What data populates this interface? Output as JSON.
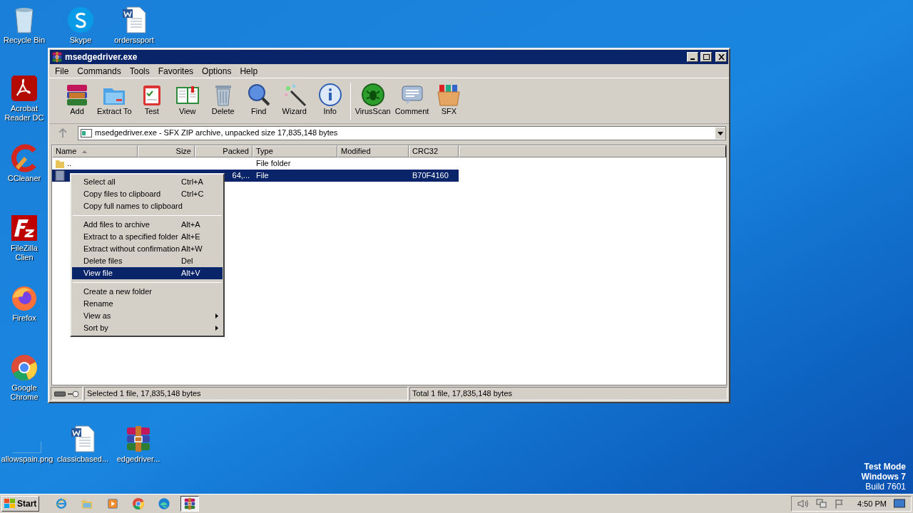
{
  "desktop_icons": [
    {
      "label": "Recycle Bin",
      "kind": "recycle"
    },
    {
      "label": "Skype",
      "kind": "skype"
    },
    {
      "label": "orderssport",
      "kind": "word"
    },
    {
      "label": "Acrobat Reader DC",
      "kind": "acrobat"
    },
    {
      "label": "CCleaner",
      "kind": "ccleaner"
    },
    {
      "label": "FileZilla Clien",
      "kind": "filezilla"
    },
    {
      "label": "Firefox",
      "kind": "firefox"
    },
    {
      "label": "Google Chrome",
      "kind": "chrome"
    },
    {
      "label": "allowspain.png",
      "kind": "blank"
    },
    {
      "label": "classicbased...",
      "kind": "word"
    },
    {
      "label": "edgedriver...",
      "kind": "winrar"
    }
  ],
  "window": {
    "title": "msedgedriver.exe",
    "menu": [
      "File",
      "Commands",
      "Tools",
      "Favorites",
      "Options",
      "Help"
    ],
    "toolbar": [
      {
        "label": "Add",
        "kind": "add"
      },
      {
        "label": "Extract To",
        "kind": "extract"
      },
      {
        "label": "Test",
        "kind": "test"
      },
      {
        "label": "View",
        "kind": "view"
      },
      {
        "label": "Delete",
        "kind": "delete"
      },
      {
        "label": "Find",
        "kind": "find"
      },
      {
        "label": "Wizard",
        "kind": "wizard"
      },
      {
        "label": "Info",
        "kind": "info"
      },
      {
        "label": "VirusScan",
        "kind": "virus"
      },
      {
        "label": "Comment",
        "kind": "comment"
      },
      {
        "label": "SFX",
        "kind": "sfx"
      }
    ],
    "address": "msedgedriver.exe - SFX ZIP archive, unpacked size 17,835,148 bytes",
    "columns": [
      {
        "label": "Name",
        "sorted": true
      },
      {
        "label": "Size",
        "sorted": false
      },
      {
        "label": "Packed",
        "sorted": false
      },
      {
        "label": "Type",
        "sorted": false
      },
      {
        "label": "Modified",
        "sorted": false
      },
      {
        "label": "CRC32",
        "sorted": false
      }
    ],
    "rows": [
      {
        "kind": "folder",
        "name": "..",
        "type": "File folder",
        "selected": false
      },
      {
        "kind": "file",
        "packed": "64,...",
        "type": "File",
        "crc": "B70F4160",
        "selected": true
      }
    ],
    "status_left": "Selected 1 file, 17,835,148 bytes",
    "status_right": "Total 1 file, 17,835,148 bytes"
  },
  "context_menu": [
    {
      "kind": "item",
      "label": "Select all",
      "shortcut": "Ctrl+A",
      "selected": false,
      "submenu": false
    },
    {
      "kind": "item",
      "label": "Copy files to clipboard",
      "shortcut": "Ctrl+C",
      "selected": false,
      "submenu": false
    },
    {
      "kind": "item",
      "label": "Copy full names to clipboard",
      "selected": false,
      "submenu": false
    },
    {
      "kind": "separator"
    },
    {
      "kind": "item",
      "label": "Add files to archive",
      "shortcut": "Alt+A",
      "selected": false,
      "submenu": false
    },
    {
      "kind": "item",
      "label": "Extract to a specified folder",
      "shortcut": "Alt+E",
      "selected": false,
      "submenu": false
    },
    {
      "kind": "item",
      "label": "Extract without confirmation",
      "shortcut": "Alt+W",
      "selected": false,
      "submenu": false
    },
    {
      "kind": "item",
      "label": "Delete files",
      "shortcut": "Del",
      "selected": false,
      "submenu": false
    },
    {
      "kind": "item",
      "label": "View file",
      "shortcut": "Alt+V",
      "selected": true,
      "submenu": false
    },
    {
      "kind": "separator"
    },
    {
      "kind": "item",
      "label": "Create a new folder",
      "selected": false,
      "submenu": false
    },
    {
      "kind": "item",
      "label": "Rename",
      "selected": false,
      "submenu": false
    },
    {
      "kind": "item",
      "label": "View as",
      "selected": false,
      "submenu": true
    },
    {
      "kind": "item",
      "label": "Sort by",
      "selected": false,
      "submenu": true
    }
  ],
  "os_notice": [
    "Test Mode",
    "Windows 7",
    "Build 7601"
  ],
  "taskbar": {
    "start": "Start",
    "apps": [
      {
        "kind": "ie",
        "selected": false
      },
      {
        "kind": "explorer",
        "selected": false
      },
      {
        "kind": "media",
        "selected": false
      },
      {
        "kind": "chrome",
        "selected": false
      },
      {
        "kind": "edge",
        "selected": false
      },
      {
        "kind": "winrar",
        "selected": true
      }
    ],
    "clock": "4:50 PM"
  }
}
